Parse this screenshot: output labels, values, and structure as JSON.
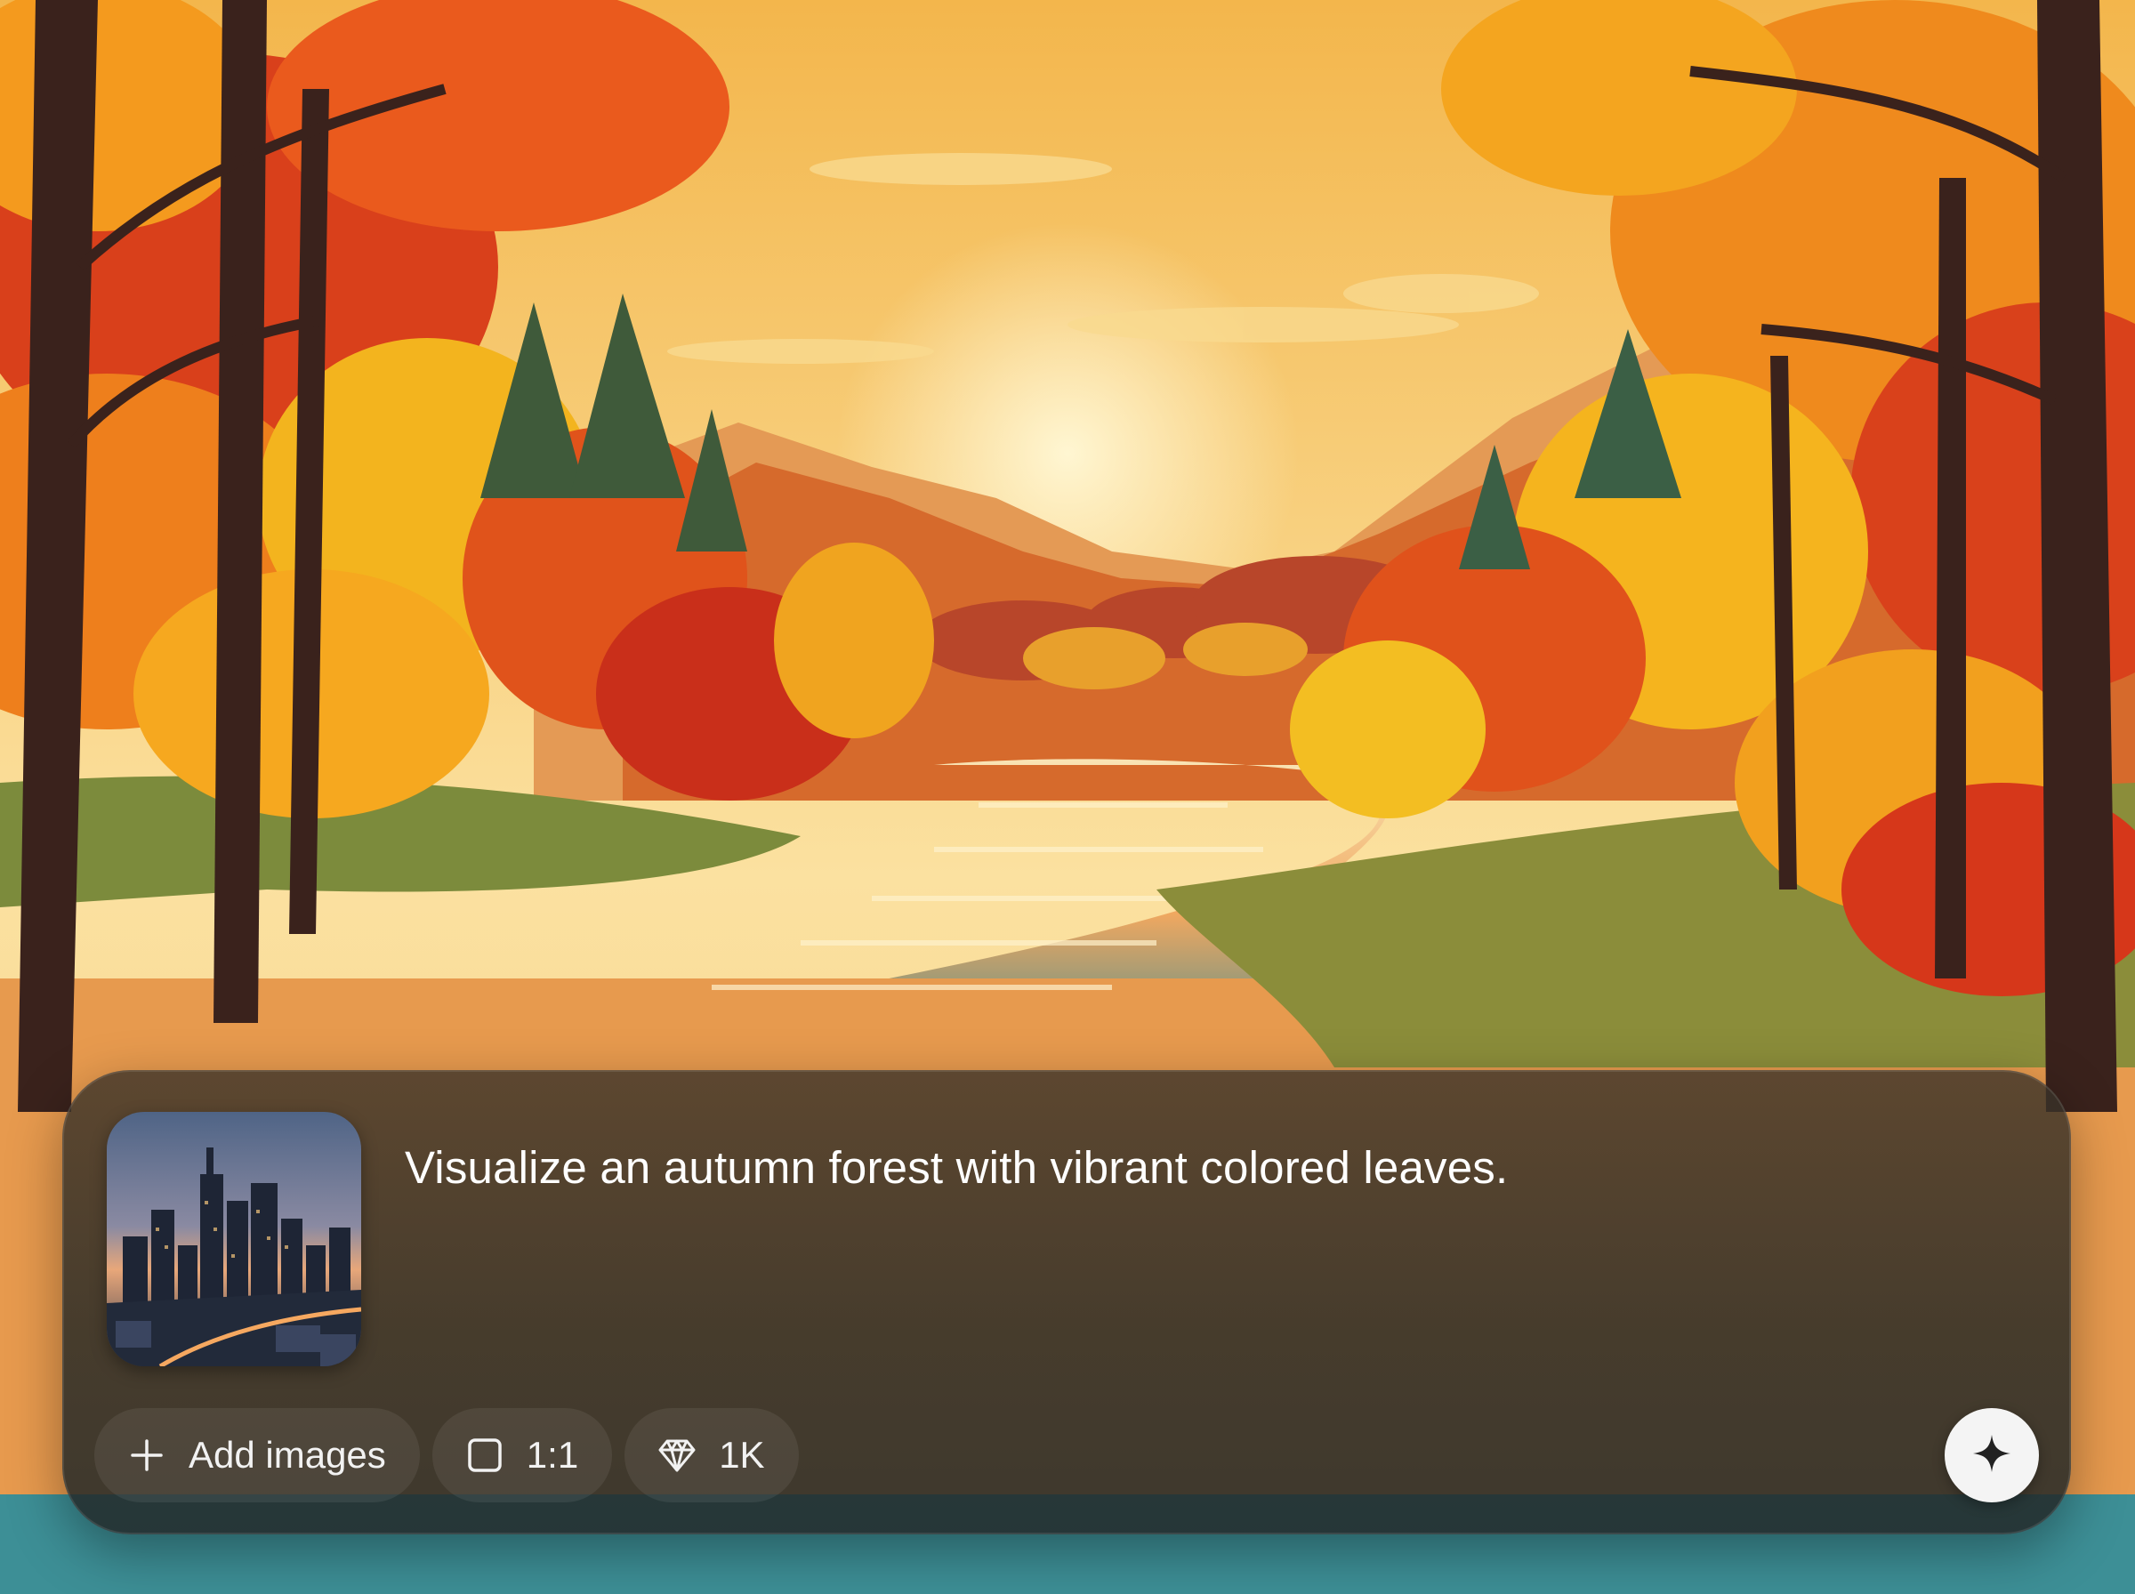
{
  "composer": {
    "prompt_text": "Visualize an autumn forest with vibrant colored leaves.",
    "add_images_label": "Add images",
    "aspect_ratio_label": "1:1",
    "resolution_label": "1K"
  },
  "icons": {
    "add": "plus-icon",
    "aspect": "square-icon",
    "resolution": "diamond-icon",
    "send": "sparkle-icon"
  },
  "colors": {
    "sky_top": "#f6c25e",
    "sky_bottom": "#fbe7a8",
    "foliage_red": "#d93a1b",
    "foliage_orange": "#f07a1a",
    "foliage_yellow": "#f5b51e",
    "river": "#f6d7a0",
    "send_button": "#f4f4f4"
  }
}
